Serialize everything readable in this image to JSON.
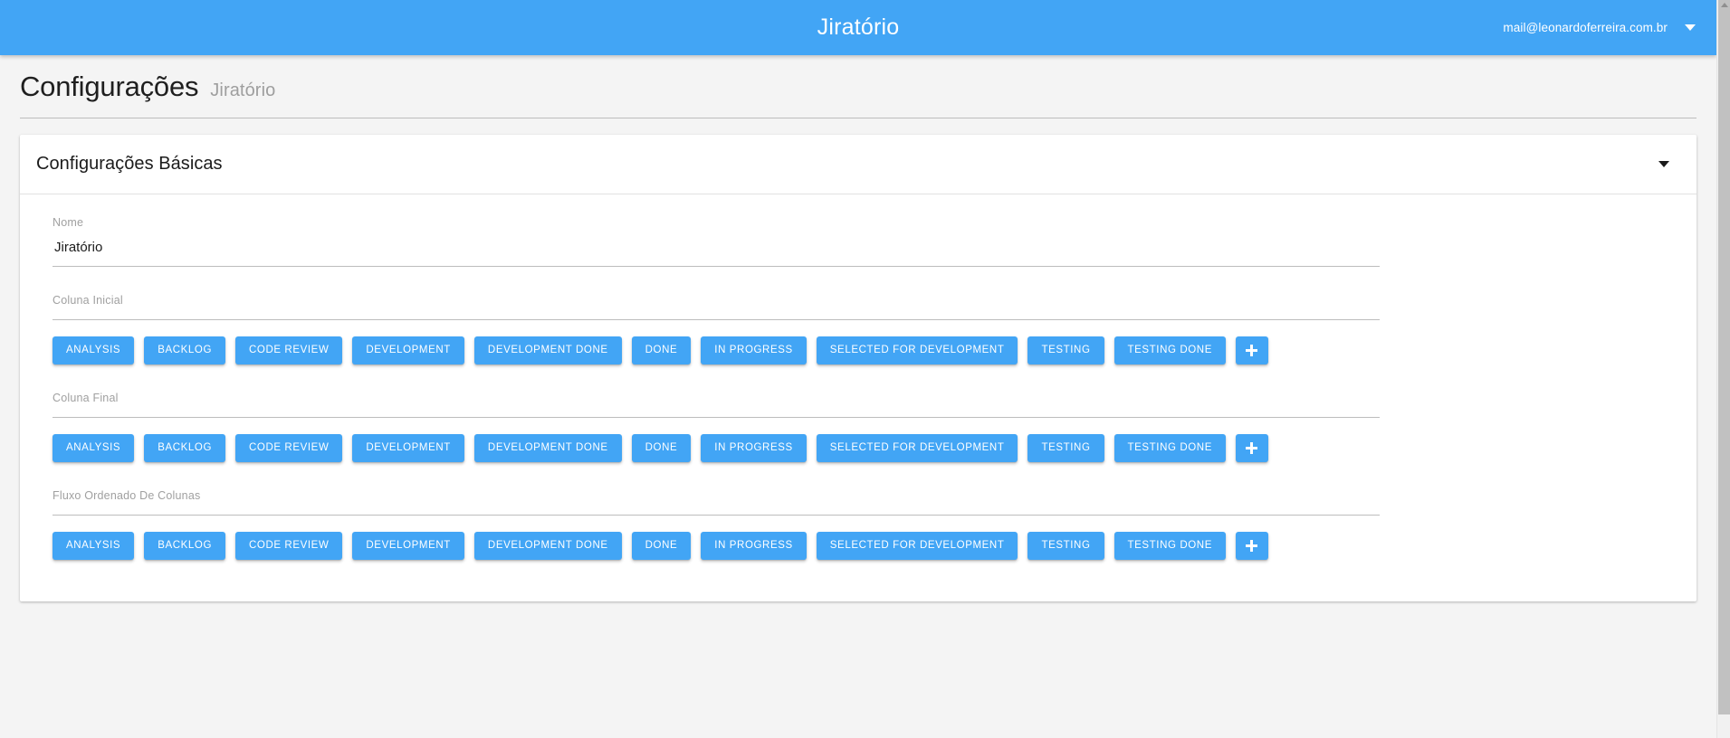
{
  "toolbar": {
    "title": "Jiratório",
    "user_email": "mail@leonardoferreira.com.br",
    "caret_icon": "chevron-down-icon"
  },
  "page": {
    "title": "Configurações",
    "subtitle": "Jiratório"
  },
  "panel": {
    "title": "Configurações Básicas",
    "toggle_icon": "chevron-down-icon",
    "expanded": true
  },
  "fields": {
    "nome": {
      "label": "Nome",
      "value": "Jiratório",
      "placeholder": "Nome"
    },
    "coluna_inicial": {
      "label": "Coluna Inicial"
    },
    "coluna_final": {
      "label": "Coluna Final"
    },
    "fluxo_ordenado": {
      "label": "Fluxo Ordenado De Colunas"
    }
  },
  "chips": [
    "ANALYSIS",
    "BACKLOG",
    "CODE REVIEW",
    "DEVELOPMENT",
    "DEVELOPMENT DONE",
    "DONE",
    "IN PROGRESS",
    "SELECTED FOR DEVELOPMENT",
    "TESTING",
    "TESTING DONE"
  ],
  "add_chip": {
    "label": "+",
    "icon": "plus-icon"
  },
  "colors": {
    "primary": "#42a5f5",
    "page_background": "#f4f4f4",
    "card_background": "#ffffff",
    "label_text": "#a0a0a0",
    "body_text": "#1b1b1b"
  }
}
